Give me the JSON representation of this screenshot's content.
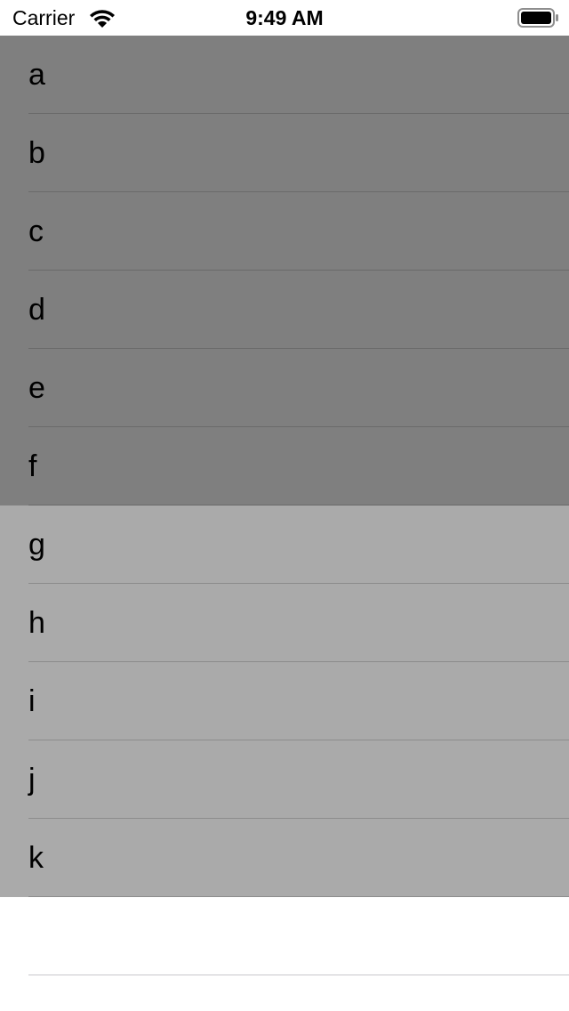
{
  "status_bar": {
    "carrier": "Carrier",
    "time": "9:49 AM",
    "wifi_icon": "wifi-icon",
    "battery_icon": "battery-icon"
  },
  "colors": {
    "dark_rows": "#7f7f7f",
    "light_rows": "#aaaaaa",
    "empty_rows": "#ffffff",
    "dark_separator": "#6a6a6a",
    "light_separator": "#8c8c8c",
    "empty_separator": "#c8c7cc"
  },
  "table": {
    "rows": [
      {
        "label": "a",
        "tone": "dark"
      },
      {
        "label": "b",
        "tone": "dark"
      },
      {
        "label": "c",
        "tone": "dark"
      },
      {
        "label": "d",
        "tone": "dark"
      },
      {
        "label": "e",
        "tone": "dark"
      },
      {
        "label": "f",
        "tone": "dark"
      },
      {
        "label": "g",
        "tone": "light"
      },
      {
        "label": "h",
        "tone": "light"
      },
      {
        "label": "i",
        "tone": "light"
      },
      {
        "label": "j",
        "tone": "light"
      },
      {
        "label": "k",
        "tone": "light"
      },
      {
        "label": "",
        "tone": "empty"
      }
    ]
  }
}
